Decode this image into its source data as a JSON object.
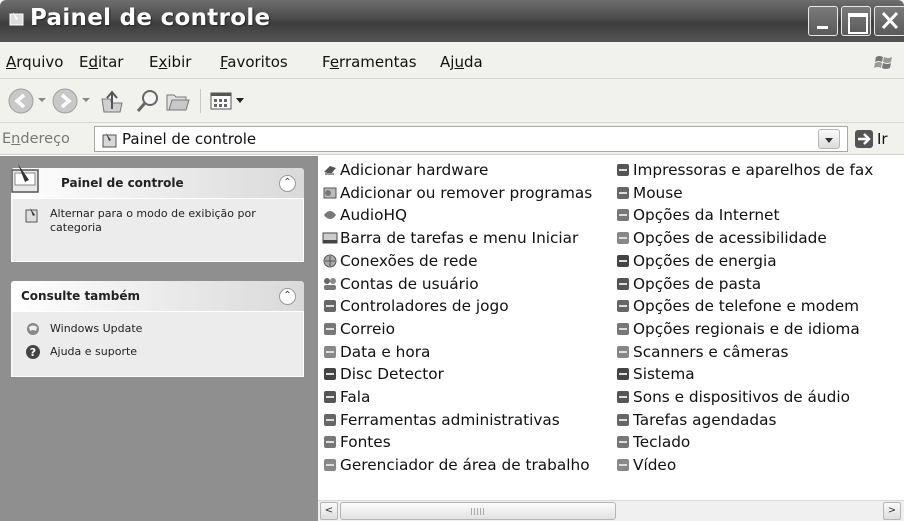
{
  "window": {
    "title": "Painel de controle"
  },
  "menubar": {
    "items": [
      {
        "pre": "",
        "key": "A",
        "post": "rquivo"
      },
      {
        "pre": "E",
        "key": "d",
        "post": "itar"
      },
      {
        "pre": "E",
        "key": "x",
        "post": "ibir"
      },
      {
        "pre": "",
        "key": "F",
        "post": "avoritos"
      },
      {
        "pre": "F",
        "key": "e",
        "post": "rramentas"
      },
      {
        "pre": "Aj",
        "key": "u",
        "post": "da"
      }
    ]
  },
  "toolbar": {
    "buttons": [
      "back-icon",
      "forward-icon",
      "up-folder-icon",
      "search-icon",
      "folders-icon",
      "views-icon"
    ]
  },
  "address": {
    "label_pre": "E",
    "label_key": "n",
    "label_post": "dereço",
    "value": "Painel de controle",
    "go_label": "Ir"
  },
  "taskpane": {
    "panel1": {
      "title": "Painel de controle",
      "link": "Alternar para o modo de exibição por categoria"
    },
    "panel2": {
      "title": "Consulte também",
      "links": [
        "Windows Update",
        "Ajuda e suporte"
      ]
    }
  },
  "items": {
    "col1": [
      {
        "label": "Adicionar hardware",
        "icon": "hardware-icon"
      },
      {
        "label": "Adicionar ou remover programas",
        "icon": "add-remove-icon"
      },
      {
        "label": "AudioHQ",
        "icon": "audiohq-icon"
      },
      {
        "label": "Barra de tarefas e menu Iniciar",
        "icon": "taskbar-icon"
      },
      {
        "label": "Conexões de rede",
        "icon": "network-icon"
      },
      {
        "label": "Contas de usuário",
        "icon": "users-icon"
      },
      {
        "label": "Controladores de jogo",
        "icon": "gamecontroller-icon"
      },
      {
        "label": "Correio",
        "icon": "mail-icon"
      },
      {
        "label": "Data e hora",
        "icon": "datetime-icon"
      },
      {
        "label": "Disc Detector",
        "icon": "disc-icon"
      },
      {
        "label": "Fala",
        "icon": "speech-icon"
      },
      {
        "label": "Ferramentas administrativas",
        "icon": "admin-tools-icon"
      },
      {
        "label": "Fontes",
        "icon": "fonts-icon"
      },
      {
        "label": "Gerenciador de área de trabalho",
        "icon": "desktop-manager-icon"
      }
    ],
    "col2": [
      {
        "label": "Impressoras e aparelhos de fax",
        "icon": "printer-icon"
      },
      {
        "label": "Mouse",
        "icon": "mouse-icon"
      },
      {
        "label": "Opções da Internet",
        "icon": "internet-options-icon"
      },
      {
        "label": "Opções de acessibilidade",
        "icon": "accessibility-icon"
      },
      {
        "label": "Opções de energia",
        "icon": "power-icon"
      },
      {
        "label": "Opções de pasta",
        "icon": "folder-options-icon"
      },
      {
        "label": "Opções de telefone e modem",
        "icon": "phone-modem-icon"
      },
      {
        "label": "Opções regionais e de idioma",
        "icon": "regional-icon"
      },
      {
        "label": "Scanners e câmeras",
        "icon": "scanner-icon"
      },
      {
        "label": "Sistema",
        "icon": "system-icon"
      },
      {
        "label": "Sons e dispositivos de áudio",
        "icon": "sound-icon"
      },
      {
        "label": "Tarefas agendadas",
        "icon": "scheduled-tasks-icon"
      },
      {
        "label": "Teclado",
        "icon": "keyboard-icon"
      },
      {
        "label": "Vídeo",
        "icon": "video-icon"
      }
    ]
  },
  "scrollbar": {
    "left_arrow": "<",
    "right_arrow": ">"
  }
}
